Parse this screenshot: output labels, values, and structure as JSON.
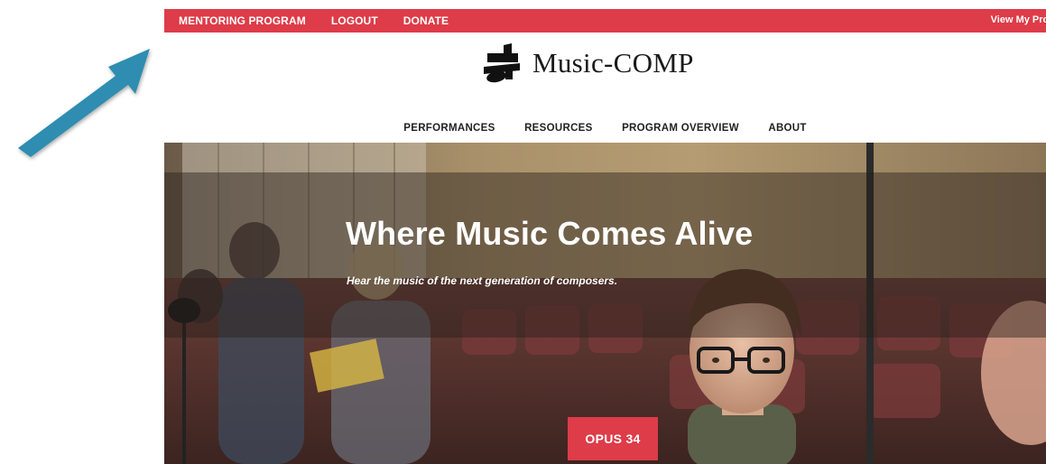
{
  "topbar": {
    "links": [
      "MENTORING PROGRAM",
      "LOGOUT",
      "DONATE"
    ],
    "profile": "View My Profi"
  },
  "logo": {
    "text": "Music-COMP",
    "icon": "music-comp-logo-icon"
  },
  "nav": {
    "items": [
      "PERFORMANCES",
      "RESOURCES",
      "PROGRAM OVERVIEW",
      "ABOUT"
    ]
  },
  "hero": {
    "title": "Where Music Comes Alive",
    "subtitle": "Hear the music of the next generation of composers.",
    "button": "OPUS 34"
  },
  "colors": {
    "brand_red": "#dd3c48",
    "annotation_arrow": "#2f8db0"
  },
  "icons": {
    "annotation": "arrow-pointer-icon"
  }
}
